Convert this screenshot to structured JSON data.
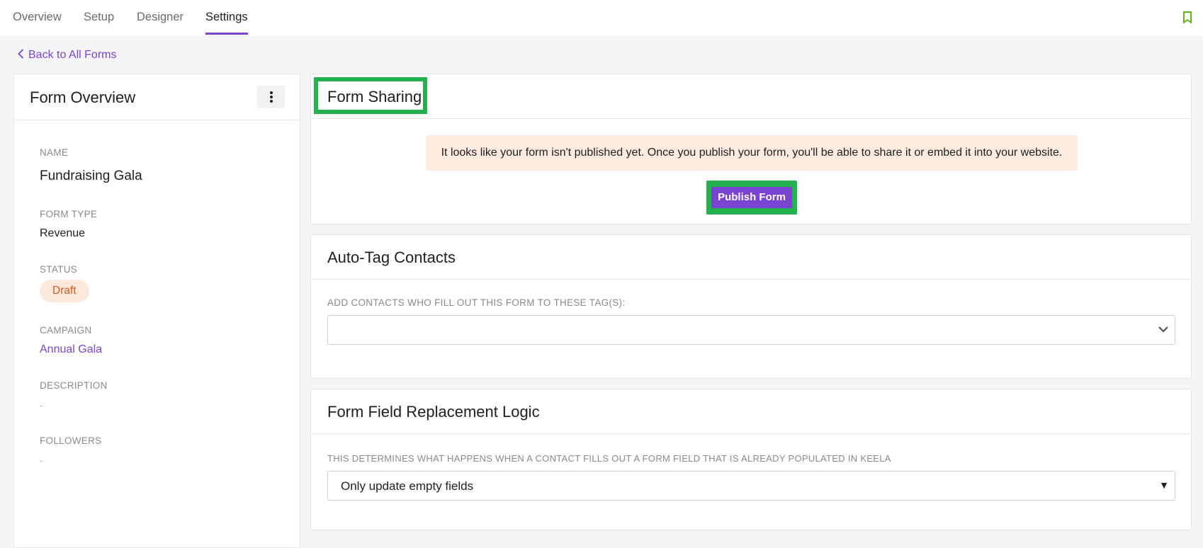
{
  "tabs": [
    {
      "label": "Overview"
    },
    {
      "label": "Setup"
    },
    {
      "label": "Designer"
    },
    {
      "label": "Settings"
    }
  ],
  "active_tab": "Settings",
  "back_link": "Back to All Forms",
  "overview": {
    "title": "Form Overview",
    "name_label": "NAME",
    "name_value": "Fundraising Gala",
    "type_label": "FORM TYPE",
    "type_value": "Revenue",
    "status_label": "STATUS",
    "status_value": "Draft",
    "campaign_label": "CAMPAIGN",
    "campaign_value": "Annual Gala",
    "description_label": "DESCRIPTION",
    "description_value": "-",
    "followers_label": "FOLLOWERS",
    "followers_value": "-"
  },
  "sharing": {
    "title": "Form Sharing",
    "notice": "It looks like your form isn't published yet. Once you publish your form, you'll be able to share it or embed it into your website.",
    "publish_label": "Publish Form"
  },
  "autotag": {
    "title": "Auto-Tag Contacts",
    "label": "ADD CONTACTS WHO FILL OUT THIS FORM TO THESE TAG(S):",
    "value": ""
  },
  "replacement": {
    "title": "Form Field Replacement Logic",
    "label": "THIS DETERMINES WHAT HAPPENS WHEN A CONTACT FILLS OUT A FORM FIELD THAT IS ALREADY POPULATED IN KEELA",
    "value": "Only update empty fields"
  },
  "colors": {
    "accent": "#7b43d1",
    "highlight": "#22b14c",
    "draft_bg": "#fde8dc",
    "draft_text": "#d55a1b",
    "notice_bg": "#fdebe0"
  }
}
